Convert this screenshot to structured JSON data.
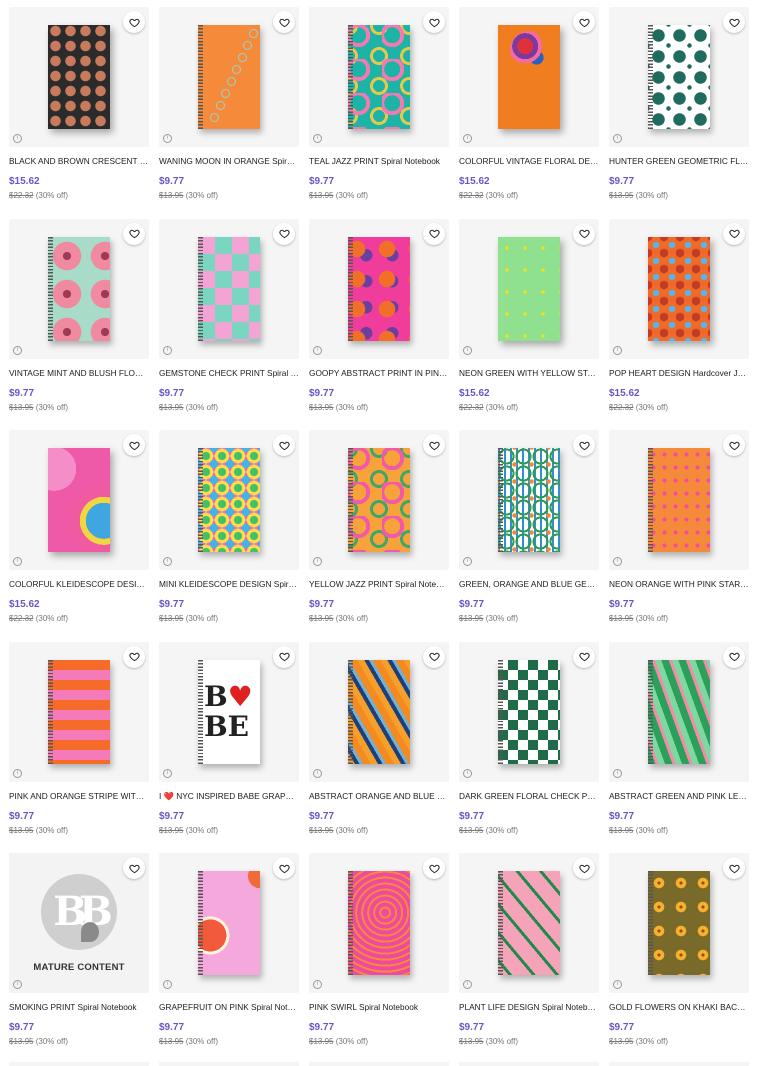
{
  "products": [
    {
      "title": "BLACK AND BROWN CRESCENT MOON PRINT Spiral Notebook",
      "price": "$15.62",
      "original": "$22.32",
      "discount": "(30% off)",
      "art": "crescent",
      "kind": "hard"
    },
    {
      "title": "WANING MOON IN ORANGE Spiral Notebook",
      "price": "$9.77",
      "original": "$13.95",
      "discount": "(30% off)",
      "art": "waning",
      "kind": "spiral"
    },
    {
      "title": "TEAL JAZZ PRINT Spiral Notebook",
      "price": "$9.77",
      "original": "$13.95",
      "discount": "(30% off)",
      "art": "tealjazz",
      "kind": "spiral"
    },
    {
      "title": "COLORFUL VINTAGE FLORAL DESIGN Hardcover Journal",
      "price": "$15.62",
      "original": "$22.32",
      "discount": "(30% off)",
      "art": "floral",
      "kind": "hard"
    },
    {
      "title": "HUNTER GREEN GEOMETRIC FLORAL Spiral Notebook",
      "price": "$9.77",
      "original": "$13.95",
      "discount": "(30% off)",
      "art": "huntergeo",
      "kind": "spiral"
    },
    {
      "title": "VINTAGE MINT AND BLUSH FLORAL Spiral Notebook",
      "price": "$9.77",
      "original": "$13.95",
      "discount": "(30% off)",
      "art": "mintblush",
      "kind": "spiral"
    },
    {
      "title": "GEMSTONE CHECK PRINT Spiral Notebook",
      "price": "$9.77",
      "original": "$13.95",
      "discount": "(30% off)",
      "art": "gemstone",
      "kind": "spiral"
    },
    {
      "title": "GOOPY ABSTRACT PRINT IN PINK Spiral Notebook",
      "price": "$9.77",
      "original": "$13.95",
      "discount": "(30% off)",
      "art": "goopy",
      "kind": "spiral"
    },
    {
      "title": "NEON GREEN WITH YELLOW STARS Hardcover Journal",
      "price": "$15.62",
      "original": "$22.32",
      "discount": "(30% off)",
      "art": "neongreen",
      "kind": "hard"
    },
    {
      "title": "POP HEART DESIGN Hardcover Journal",
      "price": "$15.62",
      "original": "$22.32",
      "discount": "(30% off)",
      "art": "popheart",
      "kind": "hard"
    },
    {
      "title": "COLORFUL KLEIDESCOPE DESIGN Hardcover Journal",
      "price": "$15.62",
      "original": "$22.32",
      "discount": "(30% off)",
      "art": "kleide",
      "kind": "hard"
    },
    {
      "title": "MINI KLEIDESCOPE DESIGN Spiral Notebook",
      "price": "$9.77",
      "original": "$13.95",
      "discount": "(30% off)",
      "art": "minikleide",
      "kind": "spiral"
    },
    {
      "title": "YELLOW JAZZ PRINT Spiral Notebook",
      "price": "$9.77",
      "original": "$13.95",
      "discount": "(30% off)",
      "art": "yellowjazz",
      "kind": "spiral"
    },
    {
      "title": "GREEN, ORANGE AND BLUE GEOMETRIC Spiral Notebook",
      "price": "$9.77",
      "original": "$13.95",
      "discount": "(30% off)",
      "art": "geo",
      "kind": "spiral"
    },
    {
      "title": "NEON ORANGE WITH PINK STARS Spiral Notebook",
      "price": "$9.77",
      "original": "$13.95",
      "discount": "(30% off)",
      "art": "orangestars",
      "kind": "spiral"
    },
    {
      "title": "PINK AND ORANGE STRIPE WITH DAISIES Spiral Notebook",
      "price": "$9.77",
      "original": "$13.95",
      "discount": "(30% off)",
      "art": "stripe",
      "kind": "spiral"
    },
    {
      "title": "I ❤️ NYC INSPIRED BABE GRAPHIC Spiral Notebook",
      "price": "$9.77",
      "original": "$13.95",
      "discount": "(30% off)",
      "art": "babe",
      "kind": "spiral"
    },
    {
      "title": "ABSTRACT ORANGE AND BLUE LINES Spiral Notebook",
      "price": "$9.77",
      "original": "$13.95",
      "discount": "(30% off)",
      "art": "orangeblue",
      "kind": "spiral"
    },
    {
      "title": "DARK GREEN FLORAL CHECK PRINT Spiral Notebook",
      "price": "$9.77",
      "original": "$13.95",
      "discount": "(30% off)",
      "art": "greencheck",
      "kind": "spiral"
    },
    {
      "title": "ABSTRACT GREEN AND PINK LEAVES Spiral Notebook",
      "price": "$9.77",
      "original": "$13.95",
      "discount": "(30% off)",
      "art": "greenpink",
      "kind": "spiral"
    },
    {
      "title": "SMOKING PRINT Spiral Notebook",
      "price": "$9.77",
      "original": "$13.95",
      "discount": "(30% off)",
      "art": "mature",
      "kind": "mature"
    },
    {
      "title": "GRAPEFRUIT ON PINK Spiral Notebook",
      "price": "$9.77",
      "original": "$13.95",
      "discount": "(30% off)",
      "art": "grapefruit",
      "kind": "spiral"
    },
    {
      "title": "PINK SWIRL Spiral Notebook",
      "price": "$9.77",
      "original": "$13.95",
      "discount": "(30% off)",
      "art": "pinkswirl",
      "kind": "spiral"
    },
    {
      "title": "PLANT LIFE DESIGN Spiral Notebook",
      "price": "$9.77",
      "original": "$13.95",
      "discount": "(30% off)",
      "art": "plant",
      "kind": "spiral"
    },
    {
      "title": "GOLD FLOWERS ON KHAKI BACKGROUND Spiral Notebook",
      "price": "$9.77",
      "original": "$13.95",
      "discount": "(30% off)",
      "art": "goldflowers",
      "kind": "spiral"
    }
  ],
  "mature_label": "MATURE CONTENT",
  "icons": {
    "favorite": "heart-outline-icon",
    "info": "info-icon"
  },
  "colors": {
    "price": "#6a55c7",
    "strike": "#777777"
  }
}
